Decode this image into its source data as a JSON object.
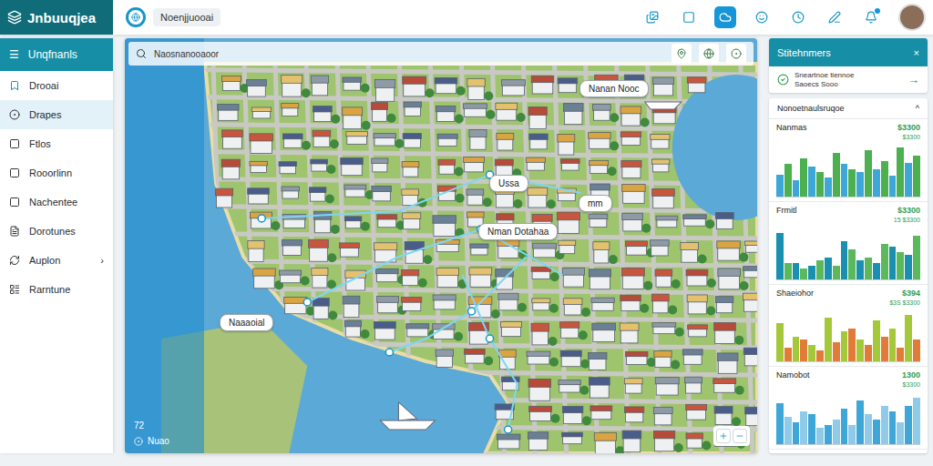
{
  "app": {
    "logo": "Jnbuuqjea"
  },
  "search": {
    "value": "Noenjjuooai"
  },
  "toolbar": {
    "buttons": [
      {
        "selected": false
      },
      {
        "selected": false
      },
      {
        "selected": true
      },
      {
        "selected": false
      },
      {
        "selected": false
      },
      {
        "selected": false
      },
      {
        "selected": false
      }
    ]
  },
  "sidebar": {
    "title": "Unqfnanls",
    "menu_icon": "☰",
    "items": [
      {
        "label": "Drooai",
        "selected": false,
        "expandable": false,
        "chevron": ""
      },
      {
        "label": "Drapes",
        "selected": true,
        "expandable": false,
        "chevron": ""
      },
      {
        "label": "Ftlos",
        "selected": false,
        "expandable": false,
        "chevron": ""
      },
      {
        "label": "Rooorlinn",
        "selected": false,
        "expandable": false,
        "chevron": ""
      },
      {
        "label": "Nachentee",
        "selected": false,
        "expandable": false,
        "chevron": ""
      },
      {
        "label": "Dorotunes",
        "selected": false,
        "expandable": false,
        "chevron": ""
      },
      {
        "label": "Auplon",
        "selected": false,
        "expandable": true,
        "chevron": "›"
      },
      {
        "label": "Rarntune",
        "selected": false,
        "expandable": false,
        "chevron": ""
      }
    ]
  },
  "map": {
    "title": "Naosnanooaoor",
    "labels": [
      {
        "text": "Nanan Nooc"
      },
      {
        "text": "Ussa"
      },
      {
        "text": "mm"
      },
      {
        "text": "Nman Dotahaa"
      },
      {
        "text": "Naaaoial"
      }
    ],
    "footer": {
      "count": "72",
      "label": "Nuao"
    }
  },
  "panel": {
    "title": "Stitehnmers",
    "close": "×",
    "notice": {
      "line1": "Sneartnoe tiennoe",
      "line2": "Saoecs Sooo",
      "arrow": "→"
    }
  },
  "summary": {
    "title": "Nonoetnaulsruqoe",
    "collapse": "^",
    "charts": [
      {
        "name": "Nanmas",
        "value": "$3300",
        "sub": "$3300",
        "series": [
          {
            "color": "#3fa6d8",
            "values": [
              40,
              30,
              55,
              35,
              60,
              45,
              50,
              38,
              62
            ]
          },
          {
            "color": "#4caf50",
            "values": [
              60,
              70,
              45,
              80,
              50,
              85,
              65,
              90,
              75
            ]
          }
        ]
      },
      {
        "name": "Frmitl",
        "value": "$3300",
        "sub": "15 $3300",
        "series": [
          {
            "color": "#1a8fb0",
            "values": [
              85,
              30,
              25,
              40,
              70,
              35,
              30,
              60,
              45
            ]
          },
          {
            "color": "#5cb85c",
            "values": [
              30,
              20,
              35,
              25,
              55,
              40,
              65,
              50,
              80
            ]
          }
        ]
      },
      {
        "name": "Shaeiohor",
        "value": "$394",
        "sub": "$3S $3300",
        "series": [
          {
            "color": "#a5c83a",
            "values": [
              70,
              45,
              30,
              80,
              55,
              40,
              75,
              60,
              85
            ]
          },
          {
            "color": "#e07b39",
            "values": [
              25,
              40,
              20,
              35,
              60,
              30,
              45,
              25,
              40
            ]
          }
        ]
      },
      {
        "name": "Namobot",
        "value": "1300",
        "sub": "$3300",
        "series": [
          {
            "color": "#3fa6d8",
            "values": [
              75,
              40,
              55,
              35,
              65,
              80,
              45,
              60,
              70
            ]
          },
          {
            "color": "#8fcbe8",
            "values": [
              50,
              60,
              30,
              45,
              35,
              55,
              70,
              40,
              85
            ]
          }
        ]
      }
    ]
  }
}
